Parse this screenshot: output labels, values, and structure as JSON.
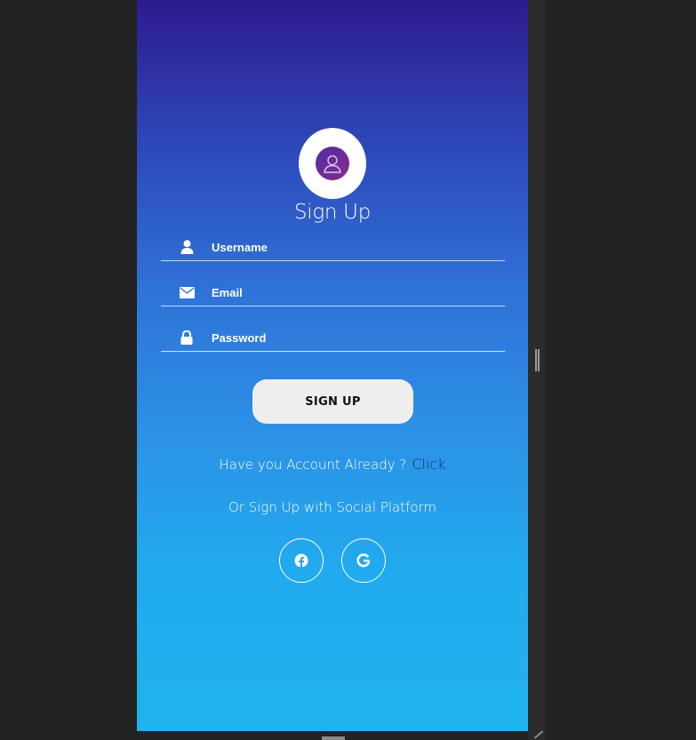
{
  "form": {
    "title": "Sign Up",
    "fields": [
      {
        "name": "username",
        "placeholder": "Username",
        "value": "",
        "icon": "user-icon"
      },
      {
        "name": "email",
        "placeholder": "Email",
        "value": "",
        "icon": "envelope-icon"
      },
      {
        "name": "password",
        "placeholder": "Password",
        "value": "",
        "icon": "lock-icon"
      }
    ],
    "submit_label": "SIGN UP"
  },
  "account": {
    "prompt": "Have you Account Already ?",
    "link_label": "Click"
  },
  "social": {
    "text": "Or Sign Up with Social Platform",
    "buttons": [
      {
        "name": "facebook",
        "icon": "facebook-icon"
      },
      {
        "name": "google",
        "icon": "google-icon"
      }
    ]
  },
  "colors": {
    "gradient_top": "#2d1b8f",
    "gradient_bottom": "#1fb4ee",
    "link": "#1c2a6b",
    "button_bg": "#eeeeee"
  }
}
